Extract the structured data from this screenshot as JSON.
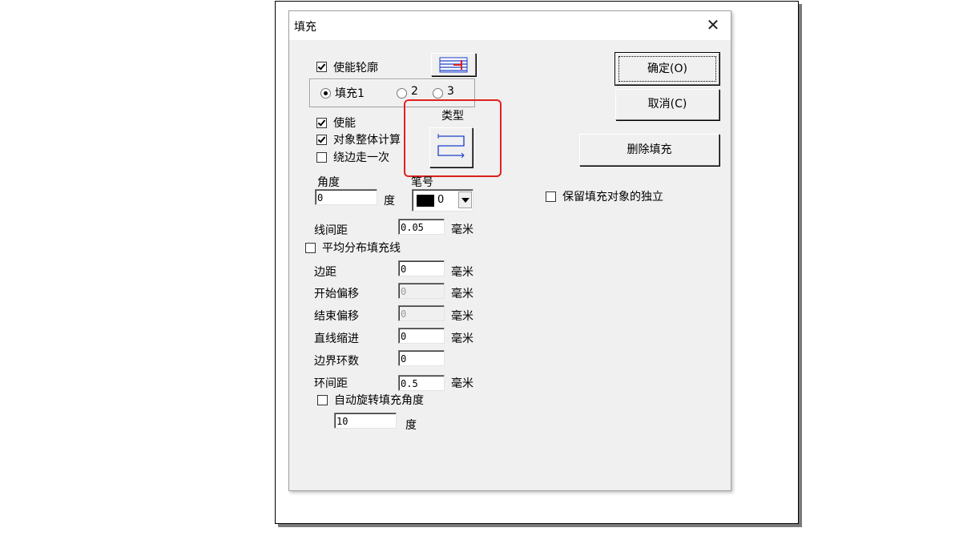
{
  "dialog": {
    "title": "填充",
    "close_symbol": "✕"
  },
  "fill": {
    "enable_outline_label": "使能轮廓",
    "fill_options": [
      "填充1",
      "2",
      "3"
    ],
    "selected_fill": "填充1",
    "enable_label": "使能",
    "whole_object_calc_label": "对象整体计算",
    "around_edge_once_label": "绕边走一次",
    "type_label": "类型",
    "angle_label": "角度",
    "angle_value": "0",
    "angle_unit": "度",
    "pen_label": "笔号",
    "pen_value": "0",
    "pen_color": "#000000",
    "line_spacing_label": "线间距",
    "line_spacing_value": "0.05",
    "mm_unit": "毫米",
    "even_distribution_label": "平均分布填充线",
    "margin_label": "边距",
    "margin_value": "0",
    "start_offset_label": "开始偏移",
    "start_offset_value": "0",
    "end_offset_label": "结束偏移",
    "end_offset_value": "0",
    "line_indent_label": "直线缩进",
    "line_indent_value": "0",
    "border_loops_label": "边界环数",
    "border_loops_value": "0",
    "loop_spacing_label": "环间距",
    "loop_spacing_value": "0.5",
    "auto_rotate_label": "自动旋转填充角度",
    "auto_rotate_value": "10",
    "auto_rotate_unit": "度"
  },
  "checkboxes": {
    "enable_outline": true,
    "enable": true,
    "whole_object_calc": true,
    "around_edge_once": false,
    "even_distribution": false,
    "auto_rotate": false,
    "keep_independent": false
  },
  "buttons": {
    "ok": "确定(O)",
    "cancel": "取消(C)",
    "delete_fill": "删除填充"
  },
  "keep_independent_label": "保留填充对象的独立",
  "colors": {
    "highlight_box": "#e02020",
    "icon_blue": "#1a3fc8"
  }
}
